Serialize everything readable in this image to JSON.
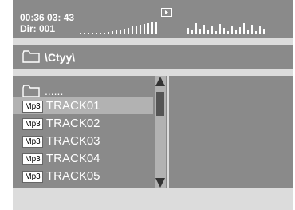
{
  "status": {
    "time": "00:36 03: 43",
    "dir": "Dir: 001",
    "play_icon": "play-icon"
  },
  "path": {
    "label": "\\Ctyy\\"
  },
  "file_list": {
    "parent": "......",
    "items": [
      {
        "badge": "Mp3",
        "name": "TRACK01",
        "selected": true
      },
      {
        "badge": "Mp3",
        "name": "TRACK02",
        "selected": false
      },
      {
        "badge": "Mp3",
        "name": "TRACK03",
        "selected": false
      },
      {
        "badge": "Mp3",
        "name": "TRACK04",
        "selected": false
      },
      {
        "badge": "Mp3",
        "name": "TRACK05",
        "selected": false
      }
    ]
  },
  "colors": {
    "panel": "#8a8a8a",
    "background": "#dcdcdc",
    "selection": "#b2b2b2",
    "text": "#ffffff"
  }
}
